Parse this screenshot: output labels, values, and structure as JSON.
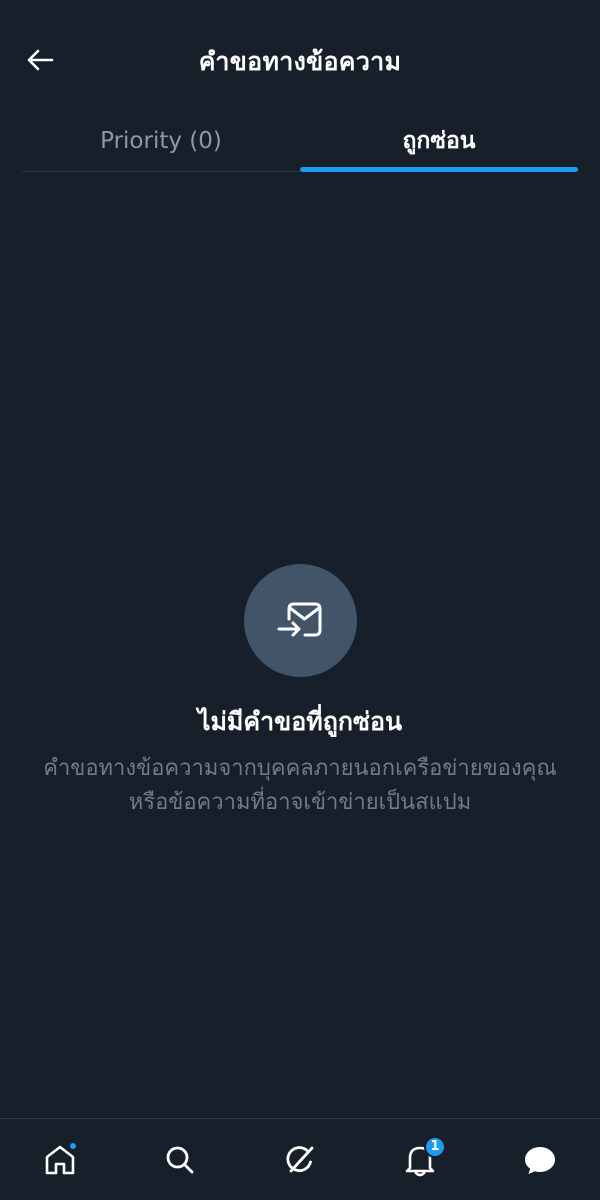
{
  "header": {
    "title": "คำขอทางข้อความ",
    "back_icon": "arrow-left-icon"
  },
  "tabs": [
    {
      "label": "Priority (0)",
      "active": false
    },
    {
      "label": "ถูกซ่อน",
      "active": true
    }
  ],
  "empty_state": {
    "icon": "envelope-arrow-icon",
    "title": "ไม่มีคำขอที่ถูกซ่อน",
    "description": "คำขอทางข้อความจากบุคคลภายนอกเครือข่ายของคุณ หรือข้อความที่อาจเข้าข่ายเป็นสแปม"
  },
  "bottom_nav": {
    "items": [
      {
        "name": "home",
        "icon": "home-icon",
        "has_dot": true
      },
      {
        "name": "search",
        "icon": "search-icon"
      },
      {
        "name": "grok",
        "icon": "grok-icon"
      },
      {
        "name": "notifications",
        "icon": "bell-icon",
        "badge": "1"
      },
      {
        "name": "messages",
        "icon": "message-bubble-icon"
      }
    ]
  },
  "colors": {
    "background": "#17202a",
    "accent": "#1d9bf0",
    "muted_text": "#8b98a5",
    "icon_circle": "#415468"
  }
}
